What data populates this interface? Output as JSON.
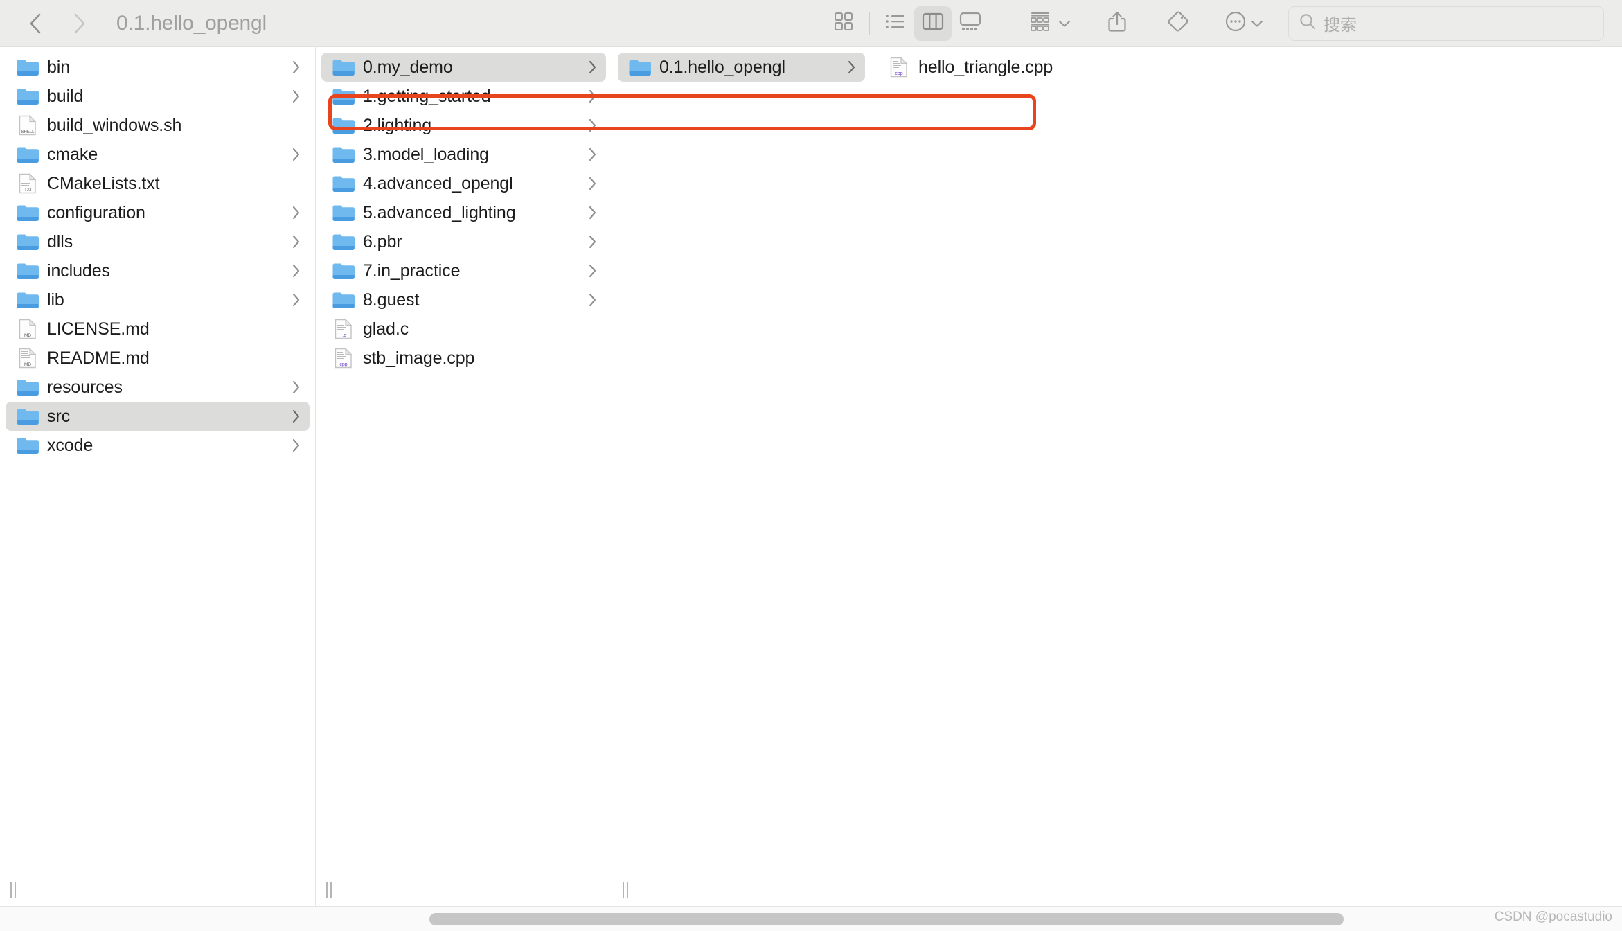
{
  "window": {
    "title": "0.1.hello_opengl",
    "app": "Finder"
  },
  "toolbar": {
    "back_label": "back-chevron",
    "forward_label": "forward-chevron",
    "title": "0.1.hello_opengl",
    "view_buttons": [
      {
        "name": "icon-view",
        "label": "Icon View",
        "active": false
      },
      {
        "name": "list-view",
        "label": "List View",
        "active": false
      },
      {
        "name": "column-view",
        "label": "Column View",
        "active": true
      },
      {
        "name": "gallery-view",
        "label": "Gallery View",
        "active": false
      }
    ],
    "group_label": "Group",
    "share_label": "Share",
    "tags_label": "Tags",
    "more_label": "More",
    "accent_red": "#e8441d",
    "toolbar_bg": "#ececeb",
    "selection_bg": "#dcdcda"
  },
  "search": {
    "placeholder": "搜索",
    "value": ""
  },
  "columns": [
    {
      "name": "column-1",
      "items": [
        {
          "label": "bin",
          "kind": "folder",
          "arrow": true,
          "selected": false
        },
        {
          "label": "build",
          "kind": "folder",
          "arrow": true,
          "selected": false
        },
        {
          "label": "build_windows.sh",
          "kind": "shell",
          "arrow": false,
          "selected": false
        },
        {
          "label": "cmake",
          "kind": "folder",
          "arrow": true,
          "selected": false
        },
        {
          "label": "CMakeLists.txt",
          "kind": "txt",
          "arrow": false,
          "selected": false
        },
        {
          "label": "configuration",
          "kind": "folder",
          "arrow": true,
          "selected": false
        },
        {
          "label": "dlls",
          "kind": "folder",
          "arrow": true,
          "selected": false
        },
        {
          "label": "includes",
          "kind": "folder",
          "arrow": true,
          "selected": false
        },
        {
          "label": "lib",
          "kind": "folder",
          "arrow": true,
          "selected": false
        },
        {
          "label": "LICENSE.md",
          "kind": "md",
          "arrow": false,
          "selected": false
        },
        {
          "label": "README.md",
          "kind": "md",
          "arrow": false,
          "selected": false
        },
        {
          "label": "resources",
          "kind": "folder",
          "arrow": true,
          "selected": false
        },
        {
          "label": "src",
          "kind": "folder",
          "arrow": true,
          "selected": true
        },
        {
          "label": "xcode",
          "kind": "folder",
          "arrow": true,
          "selected": false
        }
      ]
    },
    {
      "name": "column-2",
      "items": [
        {
          "label": "0.my_demo",
          "kind": "folder",
          "arrow": true,
          "selected": true
        },
        {
          "label": "1.getting_started",
          "kind": "folder",
          "arrow": true,
          "selected": false
        },
        {
          "label": "2.lighting",
          "kind": "folder",
          "arrow": true,
          "selected": false
        },
        {
          "label": "3.model_loading",
          "kind": "folder",
          "arrow": true,
          "selected": false
        },
        {
          "label": "4.advanced_opengl",
          "kind": "folder",
          "arrow": true,
          "selected": false
        },
        {
          "label": "5.advanced_lighting",
          "kind": "folder",
          "arrow": true,
          "selected": false
        },
        {
          "label": "6.pbr",
          "kind": "folder",
          "arrow": true,
          "selected": false
        },
        {
          "label": "7.in_practice",
          "kind": "folder",
          "arrow": true,
          "selected": false
        },
        {
          "label": "8.guest",
          "kind": "folder",
          "arrow": true,
          "selected": false
        },
        {
          "label": "glad.c",
          "kind": "c",
          "arrow": false,
          "selected": false
        },
        {
          "label": "stb_image.cpp",
          "kind": "cpp",
          "arrow": false,
          "selected": false
        }
      ]
    },
    {
      "name": "column-3",
      "items": [
        {
          "label": "0.1.hello_opengl",
          "kind": "folder",
          "arrow": true,
          "selected": true
        }
      ]
    },
    {
      "name": "column-4",
      "items": [
        {
          "label": "hello_triangle.cpp",
          "kind": "cpp",
          "arrow": false,
          "selected": false
        }
      ]
    }
  ],
  "annotation": {
    "kind": "red-rectangle-highlight",
    "color": "#e8441d"
  },
  "footer": {
    "watermark": "CSDN @pocastudio"
  }
}
